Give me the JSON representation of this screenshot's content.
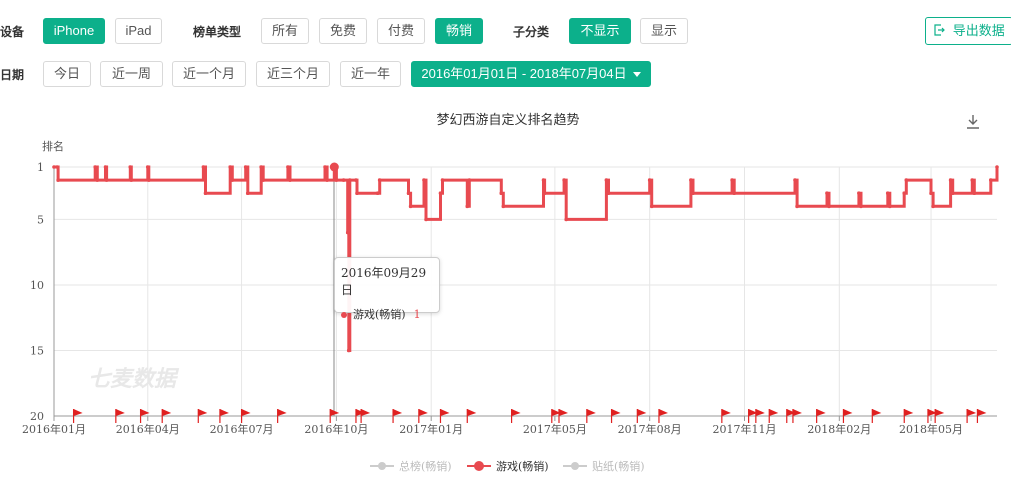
{
  "filters": {
    "device_label": "设备",
    "devices": [
      "iPhone",
      "iPad"
    ],
    "chart_type_label": "榜单类型",
    "chart_types": [
      "所有",
      "免费",
      "付费",
      "畅销"
    ],
    "subcat_label": "子分类",
    "subcat_options": [
      "不显示",
      "显示"
    ],
    "date_label": "日期",
    "date_presets": [
      "今日",
      "近一周",
      "近一个月",
      "近三个月",
      "近一年"
    ],
    "date_range": "2016年01月01日 - 2018年07月04日",
    "export_label": "导出数据"
  },
  "colors": {
    "accent": "#0cb08b",
    "series": "#e84a50",
    "inactive": "#cccccc"
  },
  "icons": {
    "export": "export-icon",
    "download": "download-icon",
    "flag": "flag-icon"
  },
  "watermark": "七麦数据",
  "tooltip": {
    "date": "2016年09月29日",
    "series": "游戏(畅销)",
    "value": "1"
  },
  "chart_data": {
    "type": "line",
    "title": "梦幻西游自定义排名趋势",
    "ylabel": "排名",
    "y_inverted": true,
    "ylim": [
      1,
      20
    ],
    "y_ticks": [
      "1",
      "5",
      "10",
      "15",
      "20"
    ],
    "x_ticks": [
      "2016年01月",
      "2016年04月",
      "2016年07月",
      "2016年10月",
      "2017年01月",
      "2017年05月",
      "2017年08月",
      "2017年11月",
      "2018年02月",
      "2018年05月"
    ],
    "legend": [
      "总榜(畅销)",
      "游戏(畅销)",
      "贴纸(畅销)"
    ],
    "legend_active": [
      false,
      true,
      false
    ],
    "legend_position": "bottom",
    "grid": true,
    "series": [
      {
        "name": "游戏(畅销)",
        "x": [
          "2016-01-01",
          "2016-01-04",
          "2016-01-05",
          "2016-02-10",
          "2016-02-12",
          "2016-02-20",
          "2016-02-21",
          "2016-03-15",
          "2016-03-16",
          "2016-04-01",
          "2016-04-02",
          "2016-05-25",
          "2016-05-27",
          "2016-06-20",
          "2016-06-22",
          "2016-07-05",
          "2016-07-07",
          "2016-07-20",
          "2016-07-22",
          "2016-08-15",
          "2016-08-17",
          "2016-09-20",
          "2016-09-22",
          "2016-09-29",
          "2016-10-01",
          "2016-10-08",
          "2016-10-12",
          "2016-10-13",
          "2016-10-14",
          "2016-10-20",
          "2016-10-21",
          "2016-11-10",
          "2016-11-12",
          "2016-12-10",
          "2016-12-12",
          "2016-12-25",
          "2016-12-27",
          "2017-01-10",
          "2017-01-12",
          "2017-02-05",
          "2017-02-07",
          "2017-03-10",
          "2017-03-12",
          "2017-04-20",
          "2017-04-21",
          "2017-05-10",
          "2017-05-12",
          "2017-06-20",
          "2017-06-22",
          "2017-08-01",
          "2017-08-03",
          "2017-09-10",
          "2017-09-12",
          "2017-10-20",
          "2017-10-22",
          "2017-12-20",
          "2017-12-22",
          "2018-01-20",
          "2018-01-22",
          "2018-02-20",
          "2018-02-22",
          "2018-03-20",
          "2018-03-22",
          "2018-04-05",
          "2018-04-07",
          "2018-05-01",
          "2018-05-03",
          "2018-05-20",
          "2018-05-22",
          "2018-06-10",
          "2018-06-12",
          "2018-06-28",
          "2018-07-04"
        ],
        "y": [
          1,
          1,
          2,
          1,
          2,
          1,
          2,
          1,
          2,
          1,
          2,
          1,
          3,
          1,
          2,
          1,
          3,
          1,
          2,
          1,
          2,
          1,
          2,
          1,
          2,
          2,
          6,
          15,
          2,
          2,
          3,
          3,
          2,
          3,
          4,
          2,
          5,
          3,
          2,
          4,
          2,
          3,
          4,
          2,
          3,
          2,
          5,
          2,
          3,
          2,
          4,
          2,
          3,
          2,
          3,
          2,
          4,
          3,
          4,
          3,
          4,
          3,
          4,
          3,
          2,
          3,
          4,
          2,
          3,
          2,
          3,
          2,
          1
        ]
      }
    ],
    "events": [
      "2016-01-20",
      "2016-03-01",
      "2016-03-25",
      "2016-04-15",
      "2016-05-20",
      "2016-06-10",
      "2016-07-01",
      "2016-08-05",
      "2016-09-25",
      "2016-10-20",
      "2016-10-25",
      "2016-11-25",
      "2016-12-20",
      "2017-01-10",
      "2017-02-05",
      "2017-03-20",
      "2017-04-28",
      "2017-05-05",
      "2017-06-01",
      "2017-06-25",
      "2017-07-20",
      "2017-08-10",
      "2017-10-10",
      "2017-11-05",
      "2017-11-12",
      "2017-11-25",
      "2017-12-12",
      "2017-12-18",
      "2018-01-10",
      "2018-02-05",
      "2018-03-05",
      "2018-04-05",
      "2018-04-28",
      "2018-05-05",
      "2018-06-05",
      "2018-06-15"
    ]
  }
}
